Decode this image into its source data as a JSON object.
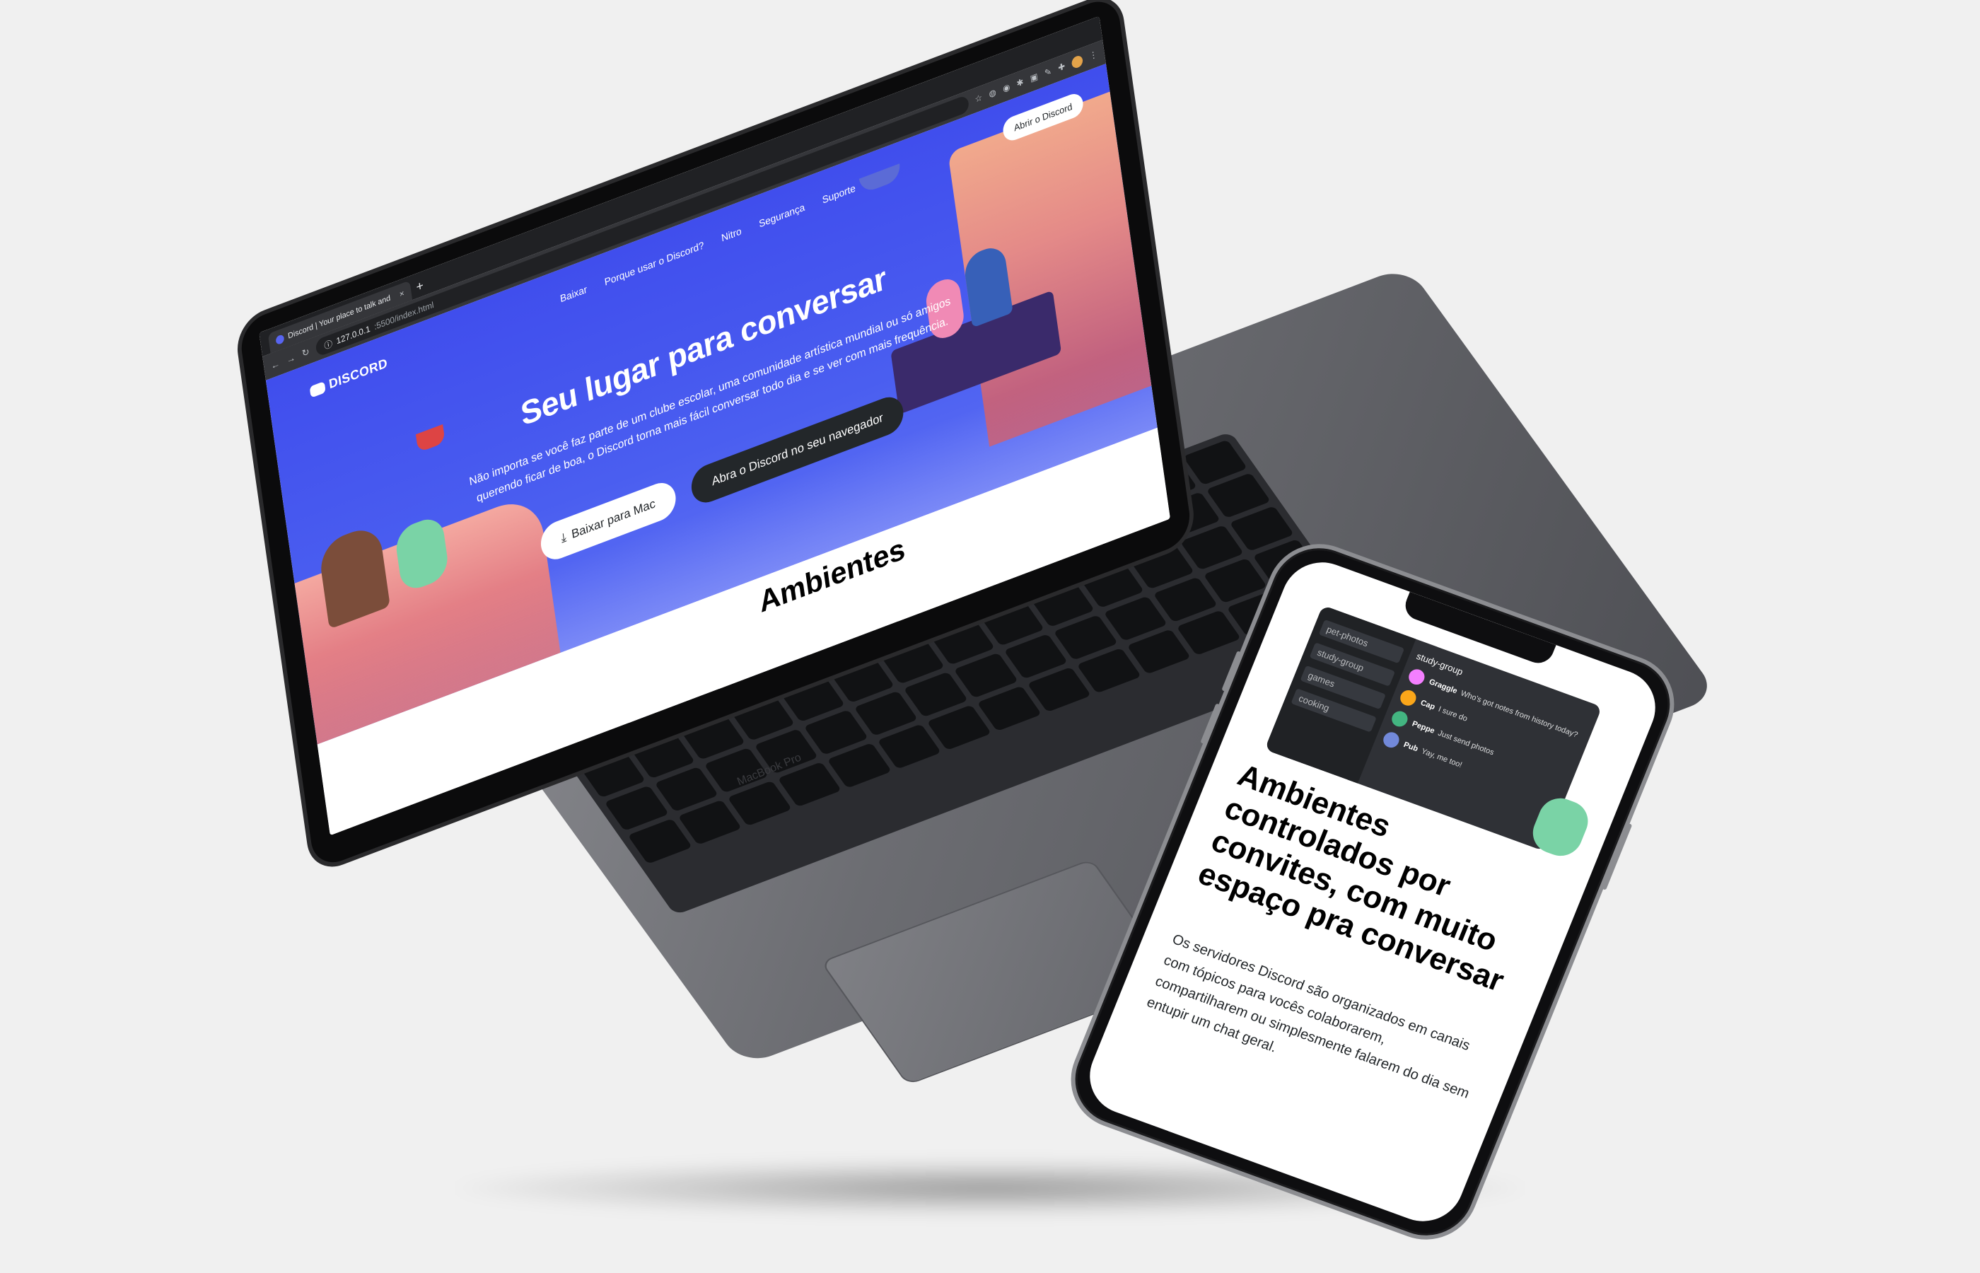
{
  "browser": {
    "tab_title": "Discord | Your place to talk and",
    "tab_close": "×",
    "new_tab": "+",
    "url_host": "127.0.0.1",
    "url_rest": ":5500/index.html"
  },
  "discord": {
    "logo_text": "DISCORD",
    "nav": [
      "Baixar",
      "Porque usar o Discord?",
      "Nitro",
      "Segurança",
      "Suporte"
    ],
    "open_button": "Abrir o Discord",
    "hero_title": "Seu lugar para conversar",
    "hero_text": "Não importa se você faz parte de um clube escolar, uma comunidade artística mundial ou só amigos querendo ficar de boa, o Discord torna mais fácil conversar todo dia e se ver com mais frequência.",
    "download_button": "Baixar para Mac",
    "browser_button": "Abra o Discord no seu navegador",
    "section_title": "Ambientes"
  },
  "laptop": {
    "brand": "MacBook Pro"
  },
  "phone": {
    "channels": [
      "pet-photos",
      "study-group",
      "games",
      "cooking"
    ],
    "chat_header": "study-group",
    "messages": [
      {
        "name": "Graggle",
        "text": "Who's got notes from history today?"
      },
      {
        "name": "Cap",
        "text": "I sure do"
      },
      {
        "name": "Peppe",
        "text": "Just send photos"
      },
      {
        "name": "Pub",
        "text": "Yay, me too!"
      }
    ],
    "title": "Ambientes controlados por convites, com muito espaço pra conversar",
    "text": "Os servidores Discord são organizados em canais com tópicos para vocês colaborarem, compartilharem ou simplesmente falarem do dia sem entupir um chat geral."
  }
}
